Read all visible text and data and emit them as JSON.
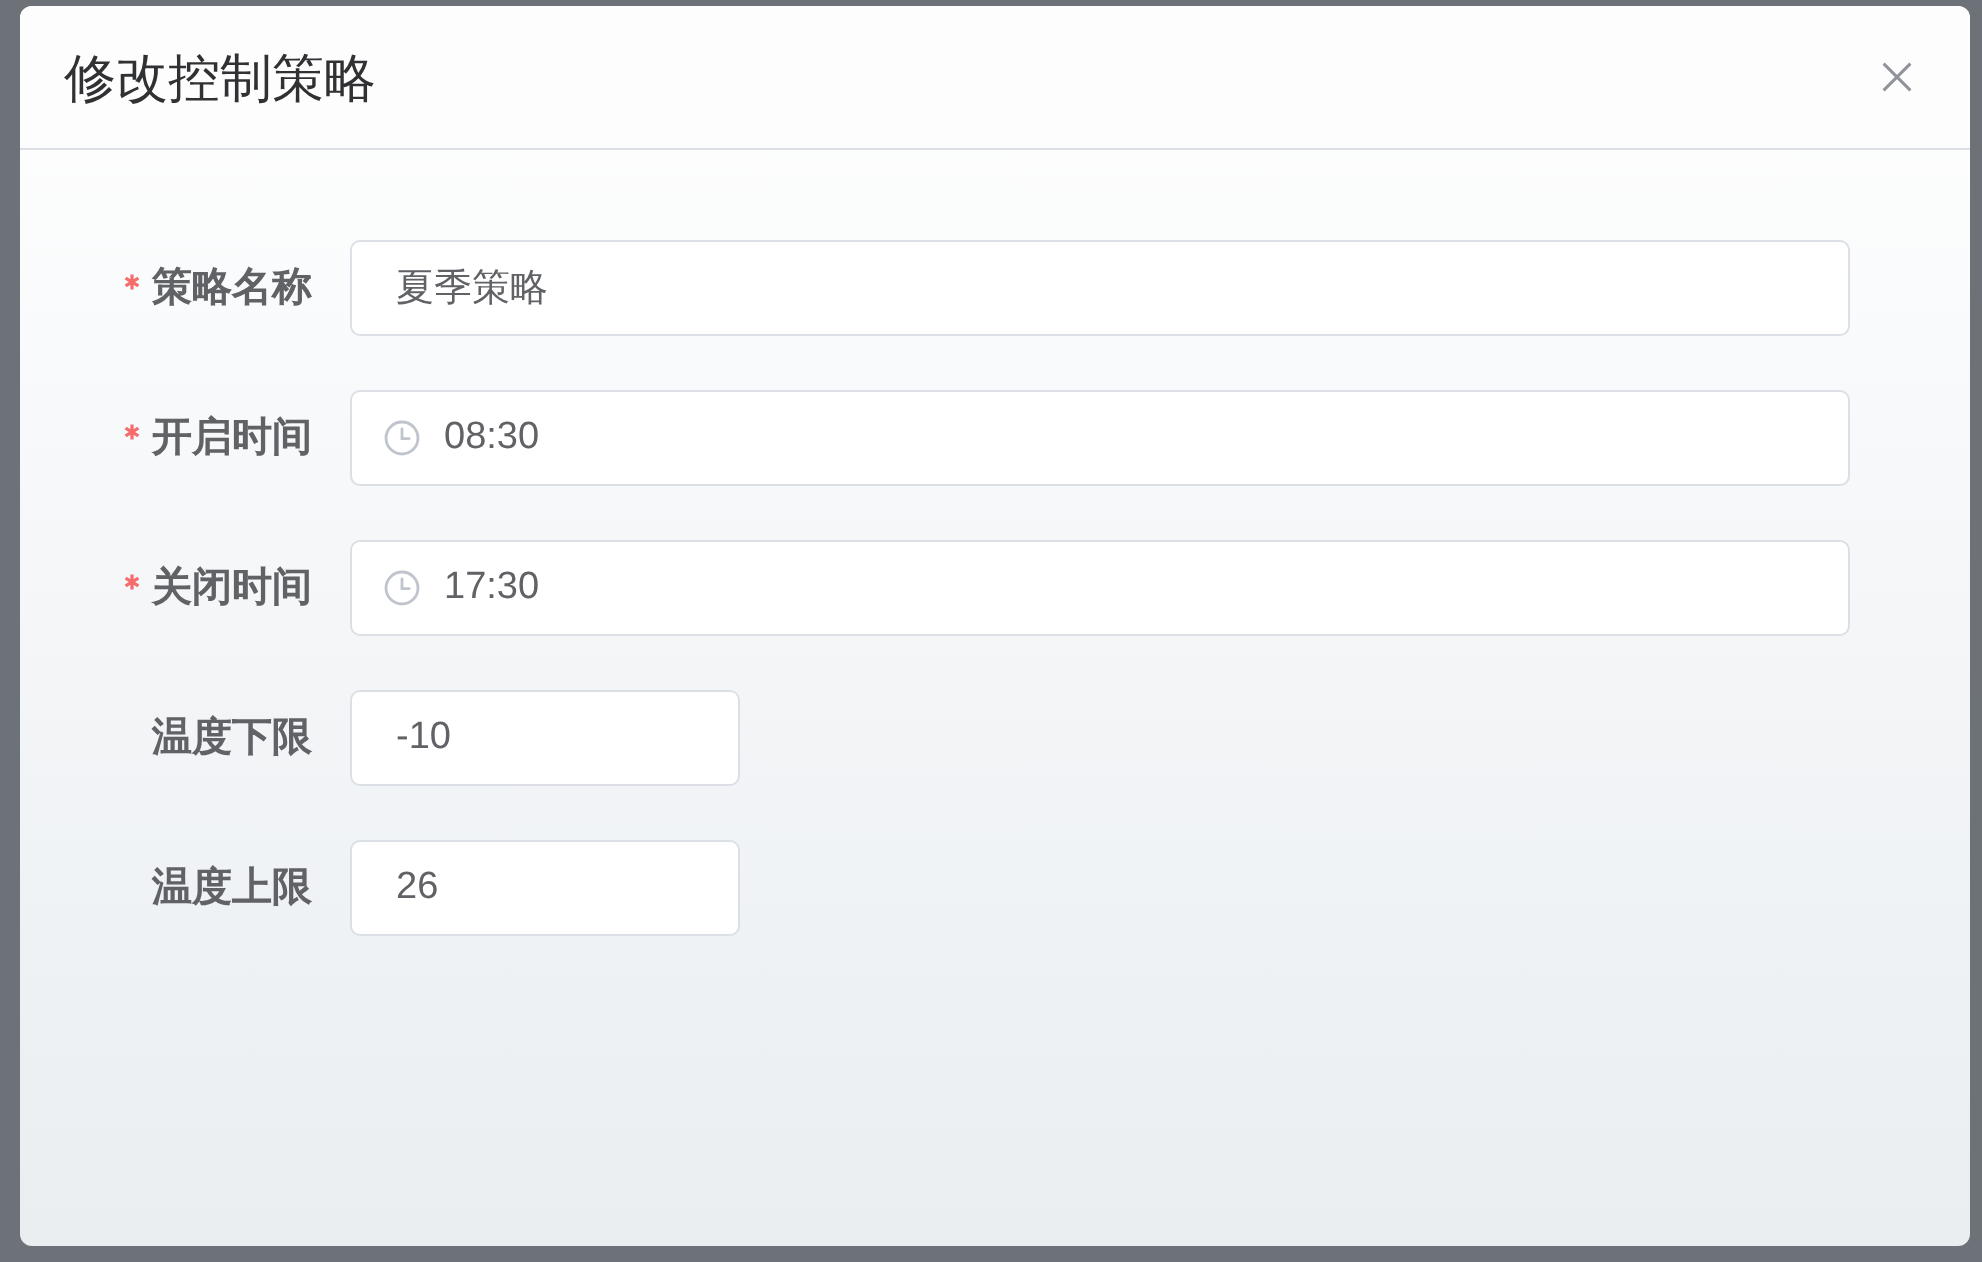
{
  "dialog": {
    "title": "修改控制策略"
  },
  "fields": [
    {
      "label": "策略名称",
      "required": true,
      "kind": "text",
      "value": "夏季策略"
    },
    {
      "label": "开启时间",
      "required": true,
      "kind": "time",
      "value": "08:30"
    },
    {
      "label": "关闭时间",
      "required": true,
      "kind": "time",
      "value": "17:30"
    },
    {
      "label": "温度下限",
      "required": false,
      "kind": "number",
      "value": "-10"
    },
    {
      "label": "温度上限",
      "required": false,
      "kind": "number",
      "value": "26"
    }
  ]
}
